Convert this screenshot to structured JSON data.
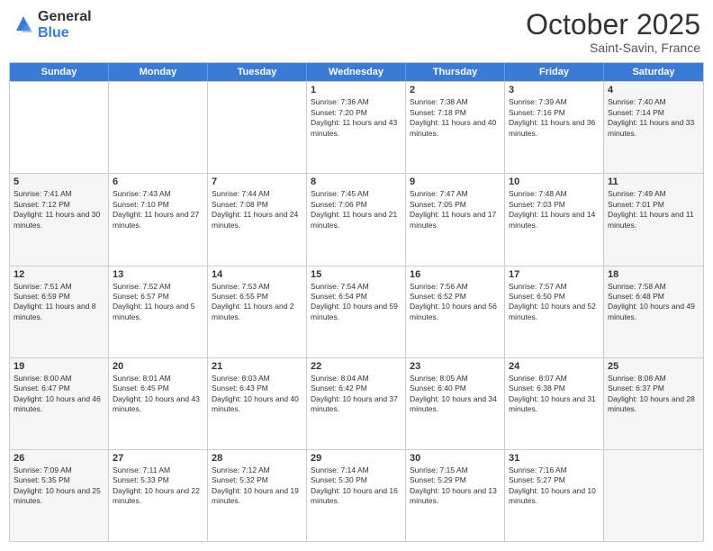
{
  "logo": {
    "general": "General",
    "blue": "Blue"
  },
  "title": "October 2025",
  "subtitle": "Saint-Savin, France",
  "header_days": [
    "Sunday",
    "Monday",
    "Tuesday",
    "Wednesday",
    "Thursday",
    "Friday",
    "Saturday"
  ],
  "rows": [
    [
      {
        "day": "",
        "text": "",
        "shaded": false
      },
      {
        "day": "",
        "text": "",
        "shaded": false
      },
      {
        "day": "",
        "text": "",
        "shaded": false
      },
      {
        "day": "1",
        "text": "Sunrise: 7:36 AM\nSunset: 7:20 PM\nDaylight: 11 hours and 43 minutes.",
        "shaded": false
      },
      {
        "day": "2",
        "text": "Sunrise: 7:38 AM\nSunset: 7:18 PM\nDaylight: 11 hours and 40 minutes.",
        "shaded": false
      },
      {
        "day": "3",
        "text": "Sunrise: 7:39 AM\nSunset: 7:16 PM\nDaylight: 11 hours and 36 minutes.",
        "shaded": false
      },
      {
        "day": "4",
        "text": "Sunrise: 7:40 AM\nSunset: 7:14 PM\nDaylight: 11 hours and 33 minutes.",
        "shaded": true
      }
    ],
    [
      {
        "day": "5",
        "text": "Sunrise: 7:41 AM\nSunset: 7:12 PM\nDaylight: 11 hours and 30 minutes.",
        "shaded": true
      },
      {
        "day": "6",
        "text": "Sunrise: 7:43 AM\nSunset: 7:10 PM\nDaylight: 11 hours and 27 minutes.",
        "shaded": false
      },
      {
        "day": "7",
        "text": "Sunrise: 7:44 AM\nSunset: 7:08 PM\nDaylight: 11 hours and 24 minutes.",
        "shaded": false
      },
      {
        "day": "8",
        "text": "Sunrise: 7:45 AM\nSunset: 7:06 PM\nDaylight: 11 hours and 21 minutes.",
        "shaded": false
      },
      {
        "day": "9",
        "text": "Sunrise: 7:47 AM\nSunset: 7:05 PM\nDaylight: 11 hours and 17 minutes.",
        "shaded": false
      },
      {
        "day": "10",
        "text": "Sunrise: 7:48 AM\nSunset: 7:03 PM\nDaylight: 11 hours and 14 minutes.",
        "shaded": false
      },
      {
        "day": "11",
        "text": "Sunrise: 7:49 AM\nSunset: 7:01 PM\nDaylight: 11 hours and 11 minutes.",
        "shaded": true
      }
    ],
    [
      {
        "day": "12",
        "text": "Sunrise: 7:51 AM\nSunset: 6:59 PM\nDaylight: 11 hours and 8 minutes.",
        "shaded": true
      },
      {
        "day": "13",
        "text": "Sunrise: 7:52 AM\nSunset: 6:57 PM\nDaylight: 11 hours and 5 minutes.",
        "shaded": false
      },
      {
        "day": "14",
        "text": "Sunrise: 7:53 AM\nSunset: 6:55 PM\nDaylight: 11 hours and 2 minutes.",
        "shaded": false
      },
      {
        "day": "15",
        "text": "Sunrise: 7:54 AM\nSunset: 6:54 PM\nDaylight: 10 hours and 59 minutes.",
        "shaded": false
      },
      {
        "day": "16",
        "text": "Sunrise: 7:56 AM\nSunset: 6:52 PM\nDaylight: 10 hours and 56 minutes.",
        "shaded": false
      },
      {
        "day": "17",
        "text": "Sunrise: 7:57 AM\nSunset: 6:50 PM\nDaylight: 10 hours and 52 minutes.",
        "shaded": false
      },
      {
        "day": "18",
        "text": "Sunrise: 7:58 AM\nSunset: 6:48 PM\nDaylight: 10 hours and 49 minutes.",
        "shaded": true
      }
    ],
    [
      {
        "day": "19",
        "text": "Sunrise: 8:00 AM\nSunset: 6:47 PM\nDaylight: 10 hours and 46 minutes.",
        "shaded": true
      },
      {
        "day": "20",
        "text": "Sunrise: 8:01 AM\nSunset: 6:45 PM\nDaylight: 10 hours and 43 minutes.",
        "shaded": false
      },
      {
        "day": "21",
        "text": "Sunrise: 8:03 AM\nSunset: 6:43 PM\nDaylight: 10 hours and 40 minutes.",
        "shaded": false
      },
      {
        "day": "22",
        "text": "Sunrise: 8:04 AM\nSunset: 6:42 PM\nDaylight: 10 hours and 37 minutes.",
        "shaded": false
      },
      {
        "day": "23",
        "text": "Sunrise: 8:05 AM\nSunset: 6:40 PM\nDaylight: 10 hours and 34 minutes.",
        "shaded": false
      },
      {
        "day": "24",
        "text": "Sunrise: 8:07 AM\nSunset: 6:38 PM\nDaylight: 10 hours and 31 minutes.",
        "shaded": false
      },
      {
        "day": "25",
        "text": "Sunrise: 8:08 AM\nSunset: 6:37 PM\nDaylight: 10 hours and 28 minutes.",
        "shaded": true
      }
    ],
    [
      {
        "day": "26",
        "text": "Sunrise: 7:09 AM\nSunset: 5:35 PM\nDaylight: 10 hours and 25 minutes.",
        "shaded": true
      },
      {
        "day": "27",
        "text": "Sunrise: 7:11 AM\nSunset: 5:33 PM\nDaylight: 10 hours and 22 minutes.",
        "shaded": false
      },
      {
        "day": "28",
        "text": "Sunrise: 7:12 AM\nSunset: 5:32 PM\nDaylight: 10 hours and 19 minutes.",
        "shaded": false
      },
      {
        "day": "29",
        "text": "Sunrise: 7:14 AM\nSunset: 5:30 PM\nDaylight: 10 hours and 16 minutes.",
        "shaded": false
      },
      {
        "day": "30",
        "text": "Sunrise: 7:15 AM\nSunset: 5:29 PM\nDaylight: 10 hours and 13 minutes.",
        "shaded": false
      },
      {
        "day": "31",
        "text": "Sunrise: 7:16 AM\nSunset: 5:27 PM\nDaylight: 10 hours and 10 minutes.",
        "shaded": false
      },
      {
        "day": "",
        "text": "",
        "shaded": true
      }
    ]
  ]
}
